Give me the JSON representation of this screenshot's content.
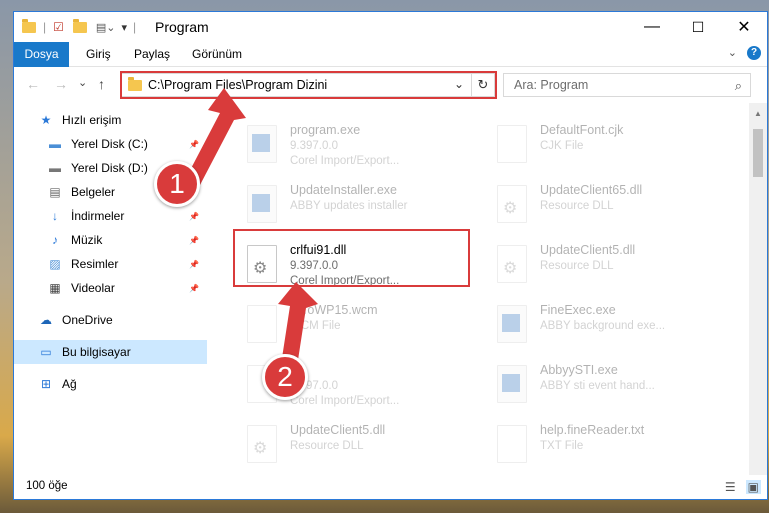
{
  "window": {
    "title": "Program",
    "controls": {
      "minimize": "—",
      "maximize": "☐",
      "close": "✕"
    }
  },
  "ribbon": {
    "tabs": [
      "Dosya",
      "Giriş",
      "Paylaş",
      "Görünüm"
    ],
    "expand": "⌄",
    "help": "?"
  },
  "nav": {
    "back": "←",
    "forward": "→",
    "recent": "⌄",
    "up": "↑",
    "address": "C:\\Program Files\\Program Dizini",
    "address_chevron": "⌄",
    "refresh": "↻",
    "search_placeholder": "Ara: Program",
    "search_icon": "⌕"
  },
  "sidebar": {
    "items": [
      {
        "label": "Hızlı erişim",
        "icon": "★",
        "icon_color": "#2b79d8",
        "pinned": false
      },
      {
        "label": "Yerel Disk (C:)",
        "icon": "▬",
        "icon_color": "#4b8fd6",
        "pinned": true
      },
      {
        "label": "Yerel Disk (D:)",
        "icon": "▬",
        "icon_color": "#777777",
        "pinned": true
      },
      {
        "label": "Belgeler",
        "icon": "▤",
        "icon_color": "#666666",
        "pinned": true
      },
      {
        "label": "İndirmeler",
        "icon": "↓",
        "icon_color": "#2b79d8",
        "pinned": true
      },
      {
        "label": "Müzik",
        "icon": "♪",
        "icon_color": "#2b79d8",
        "pinned": true
      },
      {
        "label": "Resimler",
        "icon": "▨",
        "icon_color": "#4b8fd6",
        "pinned": true
      },
      {
        "label": "Videolar",
        "icon": "▦",
        "icon_color": "#444444",
        "pinned": true
      },
      {
        "label": "OneDrive",
        "icon": "☁",
        "icon_color": "#1d66b8",
        "pinned": false
      },
      {
        "label": "Bu bilgisayar",
        "icon": "▭",
        "icon_color": "#2b79d8",
        "pinned": false
      },
      {
        "label": "Ağ",
        "icon": "⊞",
        "icon_color": "#2b79d8",
        "pinned": false
      }
    ],
    "pin_glyph": "📌"
  },
  "files": [
    {
      "name": "program.exe",
      "version": "9.397.0.0",
      "desc": "Corel Import/Export..."
    },
    {
      "name": "DefaultFont.cjk",
      "version": "CJK File",
      "desc": ""
    },
    {
      "name": "UpdateInstaller.exe",
      "version": "ABBY updates installer",
      "desc": ""
    },
    {
      "name": "UpdateClient65.dll",
      "version": "Resource DLL",
      "desc": ""
    },
    {
      "name": "crlfui91.dll",
      "version": "9.397.0.0",
      "desc": "Corel Import/Export..."
    },
    {
      "name": "UpdateClient5.dll",
      "version": "Resource DLL",
      "desc": ""
    },
    {
      "name": "rdToWP15.wcm",
      "version": "WCM File",
      "desc": ""
    },
    {
      "name": "FineExec.exe",
      "version": "ABBY background exe...",
      "desc": ""
    },
    {
      "name": "4",
      "version": "9.397.0.0",
      "desc": "Corel Import/Export..."
    },
    {
      "name": "AbbyySTI.exe",
      "version": "ABBY sti event hand...",
      "desc": ""
    },
    {
      "name": "UpdateClient5.dll",
      "version": "Resource DLL",
      "desc": ""
    },
    {
      "name": "help.fineReader.txt",
      "version": "TXT File",
      "desc": ""
    }
  ],
  "status": {
    "count": "100 öğe"
  },
  "annotations": {
    "step1": "1",
    "step2": "2",
    "color": "#d93b3b"
  }
}
